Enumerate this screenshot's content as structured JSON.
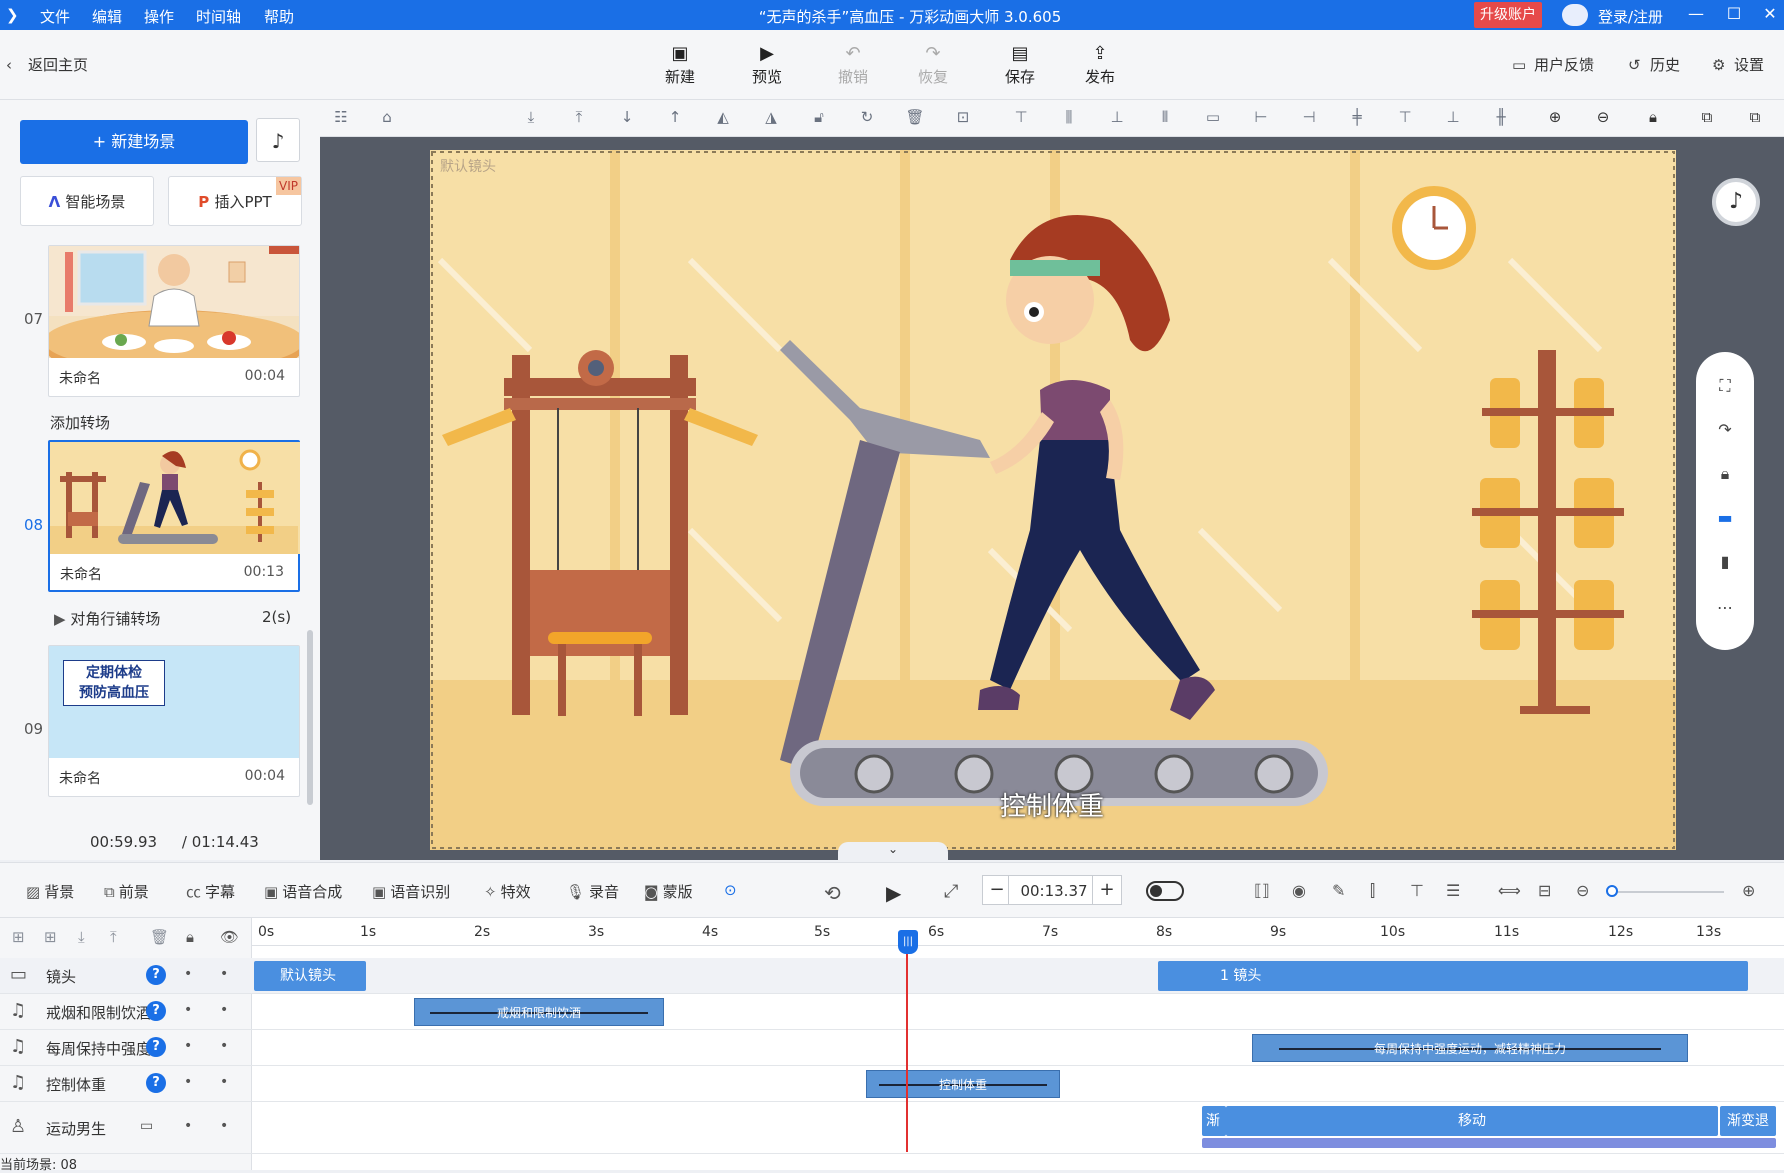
{
  "app": {
    "title": "“无声的杀手”高血压 - 万彩动画大师 3.0.605",
    "menu": [
      "文件",
      "编辑",
      "操作",
      "时间轴",
      "帮助"
    ],
    "upgrade_label": "升级账户",
    "login_label": "登录/注册"
  },
  "toolbar": {
    "back_label": "返回主页",
    "new_label": "新建",
    "preview_label": "预览",
    "undo_label": "撤销",
    "redo_label": "恢复",
    "save_label": "保存",
    "publish_label": "发布",
    "feedback_label": "用户反馈",
    "history_label": "历史",
    "settings_label": "设置"
  },
  "scenes": {
    "new_scene_label": "+ 新建场景",
    "smart_scene_label": "智能场景",
    "insert_ppt_label": "插入PPT",
    "vip_label": "VIP",
    "add_transition_label": "添加转场",
    "transition_label": "对角行铺转场",
    "transition_duration": "2(s)",
    "items": [
      {
        "num": "07",
        "name": "未命名",
        "duration": "00:04"
      },
      {
        "num": "08",
        "name": "未命名",
        "duration": "00:13"
      },
      {
        "num": "09",
        "name": "未命名",
        "duration": "00:04",
        "thumb_text_1": "定期体检",
        "thumb_text_2": "预防高血压"
      }
    ],
    "current_time": "00:59.93",
    "total_time": "/ 01:14.43"
  },
  "canvas": {
    "camera_label": "默认镜头",
    "subtitle": "控制体重"
  },
  "timeline_toolbar": {
    "background_label": "背景",
    "foreground_label": "前景",
    "caption_label": "字幕",
    "tts_label": "语音合成",
    "asr_label": "语音识别",
    "effects_label": "特效",
    "record_label": "录音",
    "mask_label": "蒙版",
    "current_time": "00:13.37",
    "minus": "−",
    "plus": "+"
  },
  "timeline": {
    "ticks": [
      "0s",
      "1s",
      "2s",
      "3s",
      "4s",
      "5s",
      "6s",
      "7s",
      "8s",
      "9s",
      "10s",
      "11s",
      "12s",
      "13s"
    ],
    "tracks": [
      {
        "name": "镜头",
        "clips": [
          {
            "label": "默认镜头"
          },
          {
            "label": "1 镜头"
          }
        ]
      },
      {
        "name": "戒烟和限制饮酒",
        "clips": [
          {
            "label": "戒烟和限制饮酒"
          }
        ]
      },
      {
        "name": "每周保持中强度运动",
        "clips": [
          {
            "label": "每周保持中强度运动，减轻精神压力"
          }
        ]
      },
      {
        "name": "控制体重",
        "clips": [
          {
            "label": "控制体重"
          }
        ]
      },
      {
        "name": "运动男生",
        "clips": [
          {
            "label": "渐"
          },
          {
            "label": "移动"
          },
          {
            "label": "渐变退"
          }
        ]
      }
    ],
    "status": "当前场景: 08"
  },
  "colors": {
    "accent": "#1a6fe6",
    "upgrade": "#e64a4a",
    "clip": "#4a8fe0",
    "playhead": "#e23030",
    "stage": "#f7dfa6"
  }
}
